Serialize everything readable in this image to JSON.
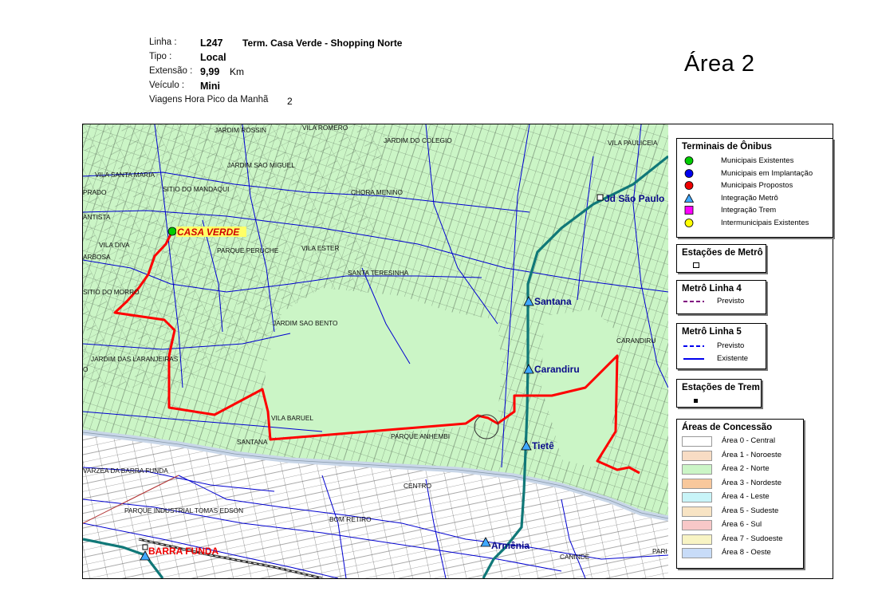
{
  "header": {
    "linha_label": "Linha :",
    "linha_code": "L247",
    "linha_name": "Term. Casa Verde - Shopping Norte",
    "tipo_label": "Tipo :",
    "tipo_value": "Local",
    "extensao_label": "Extensão :",
    "extensao_value": "9,99",
    "extensao_unit": "Km",
    "veiculo_label": "Veículo :",
    "veiculo_value": "Mini",
    "viagens_label": "Viagens Hora Pico da Manhã",
    "viagens_value": "2"
  },
  "area_title": "Área  2",
  "map": {
    "neighborhoods": [
      "JARDIM ROSSIN",
      "VILA ROMERO",
      "JARDIM DO COLEGIO",
      "VILA PAULICEIA",
      "JARDIM SAO MIGUEL",
      "VILA SANTA MARIA",
      "SITIO DO MANDAQUI",
      "PRADO",
      "CHORA MENINO",
      "ANTISTA",
      "VILA DIVA",
      "ARBOSA",
      "PARQUE PERUCHE",
      "VILA ESTER",
      "SANTA TERESINHA",
      "SITIO DO MORRO",
      "JARDIM SAO BENTO",
      "CARANDIRU",
      "JARDIM DAS LARANJEIRAS",
      "O",
      "VILA BARUEL",
      "SANTANA",
      "PARQUE ANHEMBI",
      "VARZEA DA BARRA FUNDA",
      "CENTRO",
      "PARQUE INDUSTRIAL TOMAS EDSON",
      "BOM RETIRO",
      "CANINDE",
      "PARI"
    ],
    "terminal_casa_verde": "CASA VERDE",
    "terminal_barra_funda": "BARRA FUNDA",
    "stations": [
      "Jd São Paulo",
      "Santana",
      "Carandiru",
      "Tietê",
      "Armênia"
    ],
    "colors": {
      "area2_fill": "#cbf5c6",
      "route": "#ff0000",
      "streets": "#333333",
      "avenues": "#0000d0",
      "metro_line": "#107878",
      "river": "#c8d6e8"
    }
  },
  "legend": {
    "terminais": {
      "title": "Terminais de Ônibus",
      "items": [
        {
          "label": "Municipais Existentes",
          "color": "#00cc00",
          "shape": "circle"
        },
        {
          "label": "Municipais em Implantação",
          "color": "#0000ee",
          "shape": "circle"
        },
        {
          "label": "Municipais Propostos",
          "color": "#ee0000",
          "shape": "circle"
        },
        {
          "label": "Integração Metrô",
          "color": "#40a8ff",
          "shape": "triangle"
        },
        {
          "label": "Integração Trem",
          "color": "#ff00ff",
          "shape": "square"
        },
        {
          "label": "Intermunicipais Existentes",
          "color": "#ffff00",
          "shape": "circle"
        }
      ]
    },
    "estacoes_metro": {
      "title": "Estações de Metrô"
    },
    "metro_linha4": {
      "title": "Metrô Linha 4",
      "items": [
        {
          "label": "Previsto",
          "color": "#800080",
          "style": "dashed"
        }
      ]
    },
    "metro_linha5": {
      "title": "Metrô Linha 5",
      "items": [
        {
          "label": "Previsto",
          "color": "#0000ee",
          "style": "dashed"
        },
        {
          "label": "Existente",
          "color": "#0000ee",
          "style": "solid"
        }
      ]
    },
    "estacoes_trem": {
      "title": "Estações de Trem"
    },
    "areas": {
      "title": "Áreas de Concessão",
      "items": [
        {
          "label": "Área 0 - Central",
          "color": "#ffffff"
        },
        {
          "label": "Área 1 - Noroeste",
          "color": "#f8dcc4"
        },
        {
          "label": "Área 2 - Norte",
          "color": "#cbf5c6"
        },
        {
          "label": "Área 3 - Nordeste",
          "color": "#f8c89c"
        },
        {
          "label": "Área 4 - Leste",
          "color": "#c8f4f8"
        },
        {
          "label": "Área 5 - Sudeste",
          "color": "#f8e4c4"
        },
        {
          "label": "Área 6 - Sul",
          "color": "#f8c8c8"
        },
        {
          "label": "Área 7 - Sudoeste",
          "color": "#f8f4c4"
        },
        {
          "label": "Área 8 - Oeste",
          "color": "#c8dcf8"
        }
      ]
    }
  }
}
